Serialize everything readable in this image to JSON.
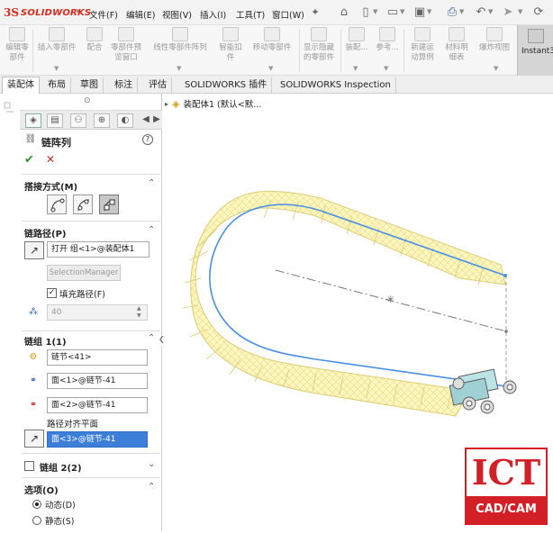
{
  "app": {
    "logo_ds": "3S",
    "logo_text": "SOLIDWORKS"
  },
  "menu": [
    "文件(F)",
    "编辑(E)",
    "视图(V)",
    "插入(I)",
    "工具(T)",
    "窗口(W)"
  ],
  "ribbon": {
    "buttons": [
      {
        "label_line1": "编辑零",
        "label_line2": "部件"
      },
      {
        "label_line1": "插入零部件",
        "label_line2": ""
      },
      {
        "label_line1": "配合",
        "label_line2": ""
      },
      {
        "label_line1": "零部件预",
        "label_line2": "览窗口"
      },
      {
        "label_line1": "线性零部件阵列",
        "label_line2": ""
      },
      {
        "label_line1": "智能扣",
        "label_line2": "件"
      },
      {
        "label_line1": "移动零部件",
        "label_line2": ""
      },
      {
        "label_line1": "显示隐藏",
        "label_line2": "的零部件"
      },
      {
        "label_line1": "装配...",
        "label_line2": ""
      },
      {
        "label_line1": "参考...",
        "label_line2": ""
      },
      {
        "label_line1": "新建运",
        "label_line2": "动算例"
      },
      {
        "label_line1": "材料明",
        "label_line2": "细表"
      },
      {
        "label_line1": "爆炸视图",
        "label_line2": ""
      }
    ],
    "instant3": "Instant3"
  },
  "tabs": [
    "装配体",
    "布局",
    "草图",
    "标注",
    "评估",
    "SOLIDWORKS 插件",
    "SOLIDWORKS Inspection"
  ],
  "tree": {
    "root_label": "装配体1 (默认<默..."
  },
  "property_manager": {
    "title": "链阵列",
    "help": "?",
    "ok": "✔",
    "cancel": "✕",
    "section_connection": "搭接方式(M)",
    "section_chain_path": "链路径(P)",
    "path_field": "打开 组<1>@装配体1",
    "selection_manager": "SelectionManager",
    "fill_path_label": "填充路径(F)",
    "fill_path_checked": "✓",
    "count_value": "40",
    "section_group1": "链组 1(1)",
    "link_field": "链节<41>",
    "face1_field": "面<1>@链节-41",
    "face2_field": "面<2>@链节-41",
    "path_align_label": "路径对齐平面",
    "face3_field": "面<3>@链节-41",
    "section_group2": "链组 2(2)",
    "section_options": "选项(O)",
    "option_dynamic": "动态(D)",
    "option_static": "静态(S)"
  },
  "watermark": {
    "big": "ICT",
    "band": "CAD/CAM"
  },
  "colors": {
    "accent_blue": "#3d7fd8",
    "chain_yellow": "#fff6b0",
    "path_blue": "#4a90e2",
    "watermark_red": "#d32027"
  }
}
